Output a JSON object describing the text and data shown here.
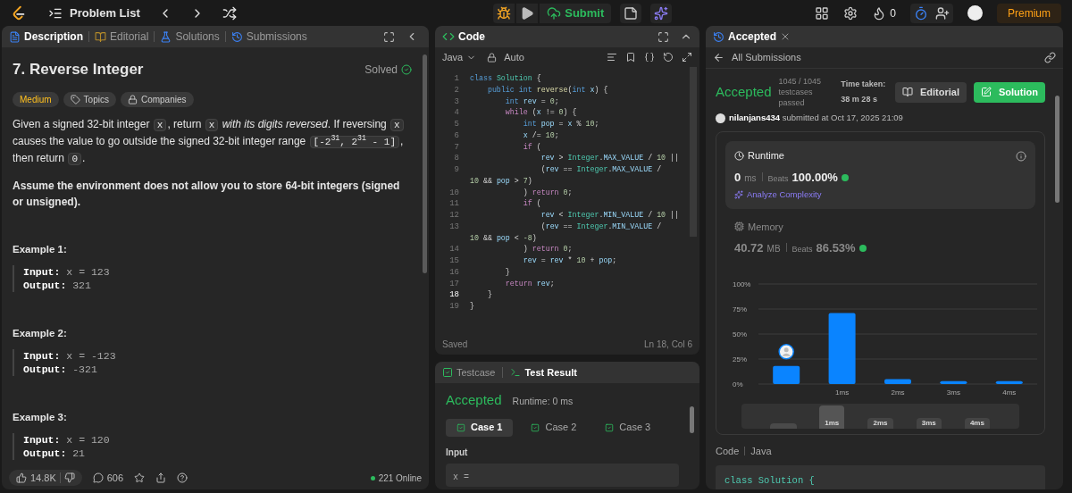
{
  "topbar": {
    "title": "Problem List",
    "submit": "Submit",
    "streak": "0",
    "premium": "Premium"
  },
  "description_panel": {
    "tabs": [
      {
        "label": "Description",
        "selected": true
      },
      {
        "label": "Editorial",
        "selected": false
      },
      {
        "label": "Solutions",
        "selected": false
      },
      {
        "label": "Submissions",
        "selected": false
      }
    ],
    "title": "7. Reverse Integer",
    "status": "Solved",
    "tags": [
      {
        "label": "Medium",
        "kind": "difficulty"
      },
      {
        "label": "Topics",
        "kind": "topics"
      },
      {
        "label": "Companies",
        "kind": "companies"
      }
    ],
    "paragraph": [
      {
        "kind": "text",
        "t": "Given a signed 32-bit integer "
      },
      {
        "kind": "code",
        "t": "x"
      },
      {
        "kind": "text",
        "t": ", return "
      },
      {
        "kind": "code",
        "t": "x"
      },
      {
        "kind": "italic",
        "t": " with its digits reversed"
      },
      {
        "kind": "text",
        "t": ". If reversing "
      },
      {
        "kind": "code",
        "t": "x"
      },
      {
        "kind": "text",
        "t": " causes the value to go outside the signed 32-bit integer range "
      },
      {
        "kind": "code",
        "t": "[-2$^{31}$, 2$^{31}$ - 1]"
      },
      {
        "kind": "text",
        "t": ", then return "
      },
      {
        "kind": "code",
        "t": "0"
      },
      {
        "kind": "text",
        "t": "."
      }
    ],
    "note": "Assume the environment does not allow you to store 64-bit integers (signed or unsigned).",
    "examples": [
      {
        "title": "Example 1:",
        "input_label": "Input:",
        "input": "x = 123",
        "output_label": "Output:",
        "output": "321"
      },
      {
        "title": "Example 2:",
        "input_label": "Input:",
        "input": "x = -123",
        "output_label": "Output:",
        "output": "-321"
      },
      {
        "title": "Example 3:",
        "input_label": "Input:",
        "input": "x = 120",
        "output_label": "Output:",
        "output": "21"
      }
    ],
    "footer": {
      "likes": "14.8K",
      "comments": "606",
      "online": "221 Online"
    }
  },
  "code_panel": {
    "title": "Code",
    "language": "Java",
    "mode": "Auto",
    "status": "Saved",
    "cursor": "Ln 18, Col 6",
    "lines": [
      {
        "n": "1",
        "current": false,
        "tokens": [
          {
            "kind": "kw",
            "t": "class"
          },
          {
            "kind": "type",
            "t": " Solution"
          },
          {
            "kind": "p",
            "t": " {"
          }
        ]
      },
      {
        "n": "2",
        "current": false,
        "tokens": [
          {
            "kind": "kw",
            "t": "    public"
          },
          {
            "kind": "kw",
            "t": " int"
          },
          {
            "kind": "fn",
            "t": " reverse"
          },
          {
            "kind": "p",
            "t": "("
          },
          {
            "kind": "kw",
            "t": "int"
          },
          {
            "kind": "var",
            "t": " x"
          },
          {
            "kind": "p",
            "t": ") {"
          }
        ]
      },
      {
        "n": "3",
        "current": false,
        "tokens": [
          {
            "kind": "kw",
            "t": "        int"
          },
          {
            "kind": "var",
            "t": " rev"
          },
          {
            "kind": "p",
            "t": " = "
          },
          {
            "kind": "num",
            "t": "0"
          },
          {
            "kind": "p",
            "t": ";"
          }
        ]
      },
      {
        "n": "4",
        "current": false,
        "tokens": [
          {
            "kind": "ctl",
            "t": "        while"
          },
          {
            "kind": "p",
            "t": " ("
          },
          {
            "kind": "var",
            "t": "x"
          },
          {
            "kind": "p",
            "t": " != "
          },
          {
            "kind": "num",
            "t": "0"
          },
          {
            "kind": "p",
            "t": ") {"
          }
        ]
      },
      {
        "n": "5",
        "current": false,
        "tokens": [
          {
            "kind": "kw",
            "t": "            int"
          },
          {
            "kind": "var",
            "t": " pop"
          },
          {
            "kind": "p",
            "t": " = "
          },
          {
            "kind": "var",
            "t": "x"
          },
          {
            "kind": "p",
            "t": " % "
          },
          {
            "kind": "num",
            "t": "10"
          },
          {
            "kind": "p",
            "t": ";"
          }
        ]
      },
      {
        "n": "6",
        "current": false,
        "tokens": [
          {
            "kind": "var",
            "t": "            x"
          },
          {
            "kind": "p",
            "t": " /= "
          },
          {
            "kind": "num",
            "t": "10"
          },
          {
            "kind": "p",
            "t": ";"
          }
        ]
      },
      {
        "n": "7",
        "current": false,
        "tokens": [
          {
            "kind": "ctl",
            "t": "            if"
          },
          {
            "kind": "p",
            "t": " ("
          }
        ]
      },
      {
        "n": "8",
        "current": false,
        "tokens": [
          {
            "kind": "var",
            "t": "                rev"
          },
          {
            "kind": "p",
            "t": " > "
          },
          {
            "kind": "type",
            "t": "Integer"
          },
          {
            "kind": "p",
            "t": "."
          },
          {
            "kind": "var",
            "t": "MAX_VALUE"
          },
          {
            "kind": "p",
            "t": " / "
          },
          {
            "kind": "num",
            "t": "10"
          },
          {
            "kind": "p",
            "t": " ||"
          }
        ]
      },
      {
        "n": "9",
        "current": false,
        "tokens": [
          {
            "kind": "p",
            "t": "                ("
          },
          {
            "kind": "var",
            "t": "rev"
          },
          {
            "kind": "p",
            "t": " == "
          },
          {
            "kind": "type",
            "t": "Integer"
          },
          {
            "kind": "p",
            "t": "."
          },
          {
            "kind": "var",
            "t": "MAX_VALUE"
          },
          {
            "kind": "p",
            "t": " /"
          }
        ]
      },
      {
        "tokens": [
          {
            "kind": "num",
            "t": "10"
          },
          {
            "kind": "p",
            "t": " && "
          },
          {
            "kind": "var",
            "t": "pop"
          },
          {
            "kind": "p",
            "t": " > "
          },
          {
            "kind": "num",
            "t": "7"
          },
          {
            "kind": "p",
            "t": ")"
          }
        ]
      },
      {
        "n": "10",
        "current": false,
        "tokens": [
          {
            "kind": "p",
            "t": "            ) "
          },
          {
            "kind": "ctl",
            "t": "return"
          },
          {
            "kind": "num",
            "t": " 0"
          },
          {
            "kind": "p",
            "t": ";"
          }
        ]
      },
      {
        "n": "11",
        "current": false,
        "tokens": [
          {
            "kind": "ctl",
            "t": "            if"
          },
          {
            "kind": "p",
            "t": " ("
          }
        ]
      },
      {
        "n": "12",
        "current": false,
        "tokens": [
          {
            "kind": "var",
            "t": "                rev"
          },
          {
            "kind": "p",
            "t": " < "
          },
          {
            "kind": "type",
            "t": "Integer"
          },
          {
            "kind": "p",
            "t": "."
          },
          {
            "kind": "var",
            "t": "MIN_VALUE"
          },
          {
            "kind": "p",
            "t": " / "
          },
          {
            "kind": "num",
            "t": "10"
          },
          {
            "kind": "p",
            "t": " ||"
          }
        ]
      },
      {
        "n": "13",
        "current": false,
        "tokens": [
          {
            "kind": "p",
            "t": "                ("
          },
          {
            "kind": "var",
            "t": "rev"
          },
          {
            "kind": "p",
            "t": " == "
          },
          {
            "kind": "type",
            "t": "Integer"
          },
          {
            "kind": "p",
            "t": "."
          },
          {
            "kind": "var",
            "t": "MIN_VALUE"
          },
          {
            "kind": "p",
            "t": " /"
          }
        ]
      },
      {
        "tokens": [
          {
            "kind": "num",
            "t": "10"
          },
          {
            "kind": "p",
            "t": " && "
          },
          {
            "kind": "var",
            "t": "pop"
          },
          {
            "kind": "p",
            "t": " < "
          },
          {
            "kind": "num",
            "t": "-8"
          },
          {
            "kind": "p",
            "t": ")"
          }
        ]
      },
      {
        "n": "14",
        "current": false,
        "tokens": [
          {
            "kind": "p",
            "t": "            ) "
          },
          {
            "kind": "ctl",
            "t": "return"
          },
          {
            "kind": "num",
            "t": " 0"
          },
          {
            "kind": "p",
            "t": ";"
          }
        ]
      },
      {
        "n": "15",
        "current": false,
        "tokens": [
          {
            "kind": "var",
            "t": "            rev"
          },
          {
            "kind": "p",
            "t": " = "
          },
          {
            "kind": "var",
            "t": "rev"
          },
          {
            "kind": "p",
            "t": " * "
          },
          {
            "kind": "num",
            "t": "10"
          },
          {
            "kind": "p",
            "t": " + "
          },
          {
            "kind": "var",
            "t": "pop"
          },
          {
            "kind": "p",
            "t": ";"
          }
        ]
      },
      {
        "n": "16",
        "current": false,
        "tokens": [
          {
            "kind": "p",
            "t": "        }"
          }
        ]
      },
      {
        "n": "17",
        "current": false,
        "tokens": [
          {
            "kind": "ctl",
            "t": "        return"
          },
          {
            "kind": "var",
            "t": " rev"
          },
          {
            "kind": "p",
            "t": ";"
          }
        ]
      },
      {
        "n": "18",
        "current": true,
        "tokens": [
          {
            "kind": "p",
            "t": "    }"
          }
        ]
      },
      {
        "n": "19",
        "current": false,
        "tokens": [
          {
            "kind": "p",
            "t": "}"
          }
        ]
      }
    ]
  },
  "test_panel": {
    "tabs": [
      {
        "label": "Testcase",
        "selected": false
      },
      {
        "label": "Test Result",
        "selected": true
      }
    ],
    "verdict": "Accepted",
    "runtime": "Runtime: 0 ms",
    "cases": [
      {
        "label": "Case 1",
        "selected": true,
        "passed": true
      },
      {
        "label": "Case 2",
        "selected": false,
        "passed": true
      },
      {
        "label": "Case 3",
        "selected": false,
        "passed": true
      }
    ],
    "input_label": "Input",
    "input_value": "x ="
  },
  "submission_panel": {
    "tab": "Accepted",
    "back": "All Submissions",
    "verdict": "Accepted",
    "passed": "1045 / 1045",
    "passed_label": "testcases passed",
    "time_taken": "Time taken: 38 m 28 s",
    "buttons": [
      {
        "label": "Editorial",
        "kind": "secondary"
      },
      {
        "label": "Solution",
        "kind": "primary"
      }
    ],
    "user": "nilanjans434",
    "submitted": "submitted at Oct 17, 2025 21:09",
    "metrics": [
      {
        "title": "Runtime",
        "kind": "runtime",
        "value": "0",
        "unit": "ms",
        "beats_label": "Beats",
        "beats": "100.00%",
        "analyze": "Analyze Complexity",
        "selected": true
      },
      {
        "title": "Memory",
        "kind": "memory",
        "value": "40.72",
        "unit": "MB",
        "beats_label": "Beats",
        "beats": "86.53%",
        "selected": false
      }
    ],
    "chart_data": {
      "type": "bar",
      "grid": true,
      "x": [
        0,
        1,
        2,
        3,
        4
      ],
      "values": [
        18,
        71,
        5,
        3,
        3
      ],
      "xlim": [
        -0.5,
        4.5
      ],
      "ylim": [
        0,
        100
      ],
      "yticks": [
        {
          "value": 0,
          "label": "0%"
        },
        {
          "value": 25,
          "label": "25%"
        },
        {
          "value": 50,
          "label": "50%"
        },
        {
          "value": 75,
          "label": "75%"
        },
        {
          "value": 100,
          "label": "100%"
        }
      ],
      "xticks": [
        {
          "value": 1,
          "label": "1ms"
        },
        {
          "value": 2,
          "label": "2ms"
        },
        {
          "value": 3,
          "label": "3ms"
        },
        {
          "value": 4,
          "label": "4ms"
        }
      ]
    },
    "overview_labels": [
      "1ms",
      "2ms",
      "3ms",
      "4ms"
    ],
    "code_label": "Code",
    "code_language": "Java",
    "code_preview": "class Solution {"
  }
}
